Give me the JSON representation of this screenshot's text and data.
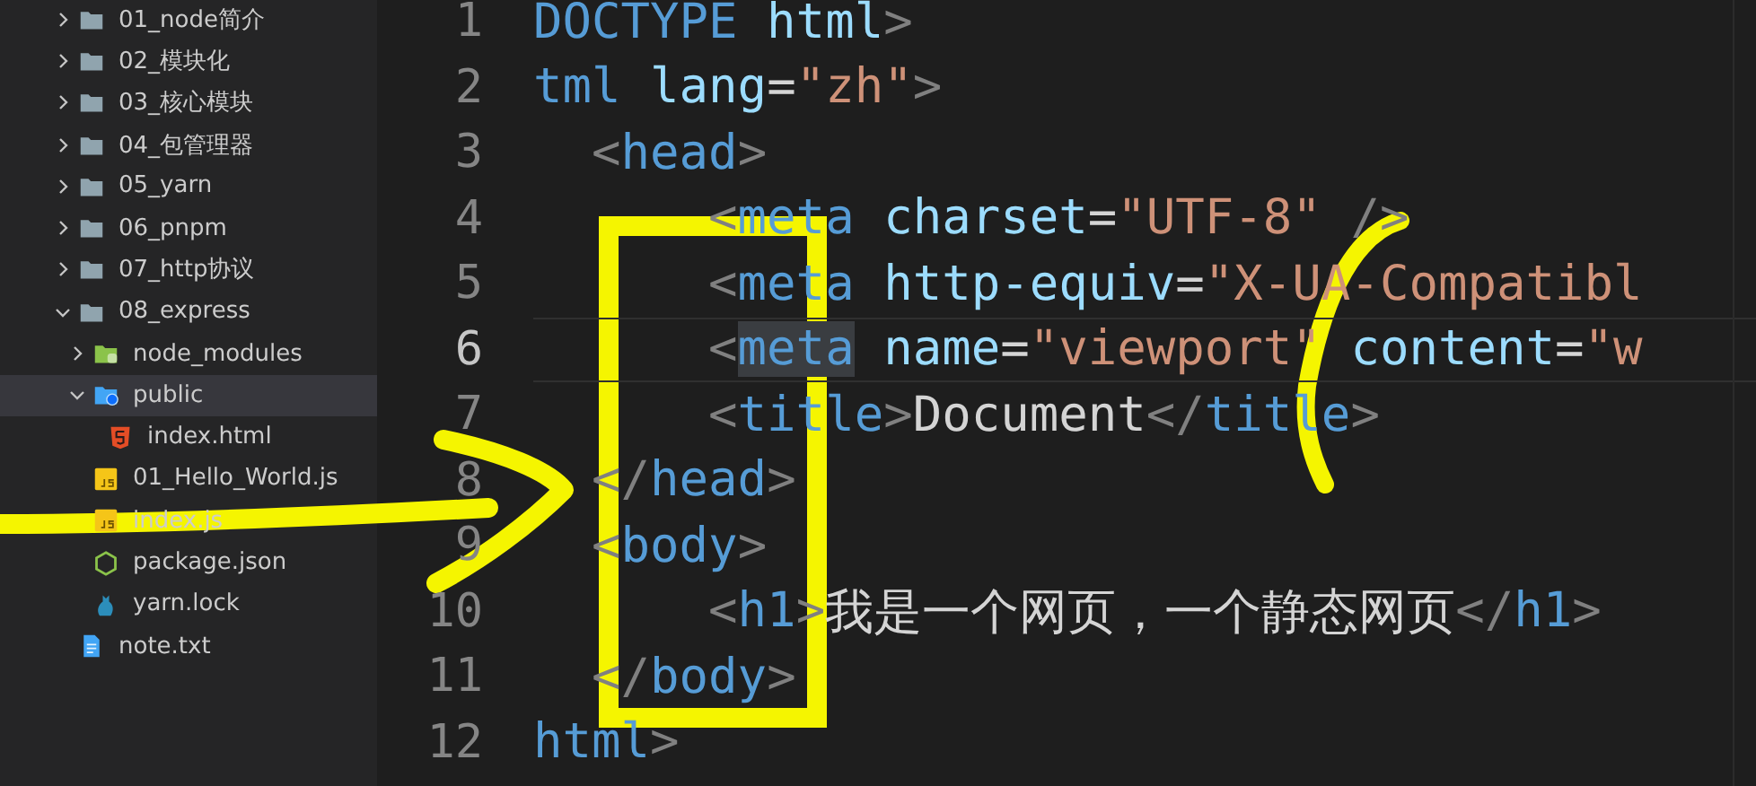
{
  "sidebar": {
    "items": [
      {
        "label": "01_node简介",
        "kind": "folder",
        "expanded": false,
        "selected": false
      },
      {
        "label": "02_模块化",
        "kind": "folder",
        "expanded": false,
        "selected": false
      },
      {
        "label": "03_核心模块",
        "kind": "folder",
        "expanded": false,
        "selected": false
      },
      {
        "label": "04_包管理器",
        "kind": "folder",
        "expanded": false,
        "selected": false
      },
      {
        "label": "05_yarn",
        "kind": "folder",
        "expanded": false,
        "selected": false
      },
      {
        "label": "06_pnpm",
        "kind": "folder",
        "expanded": false,
        "selected": false
      },
      {
        "label": "07_http协议",
        "kind": "folder",
        "expanded": false,
        "selected": false
      },
      {
        "label": "08_express",
        "kind": "folder",
        "expanded": true,
        "selected": false,
        "children": [
          {
            "label": "node_modules",
            "kind": "node-folder",
            "expanded": false,
            "selected": false
          },
          {
            "label": "public",
            "kind": "web-folder",
            "expanded": true,
            "selected": true,
            "children": [
              {
                "label": "index.html",
                "kind": "html",
                "selected": false
              }
            ]
          },
          {
            "label": "01_Hello_World.js",
            "kind": "js",
            "selected": false
          },
          {
            "label": "index.js",
            "kind": "js",
            "selected": false
          },
          {
            "label": "package.json",
            "kind": "npm",
            "selected": false
          },
          {
            "label": "yarn.lock",
            "kind": "yarn",
            "selected": false
          }
        ]
      },
      {
        "label": "note.txt",
        "kind": "txt",
        "selected": false
      }
    ]
  },
  "code": {
    "lines": [
      {
        "number": "1",
        "current": false,
        "tokens": [
          {
            "kind": "tag",
            "text": "DOCTYPE"
          },
          {
            "kind": "attr",
            "text": " html"
          },
          {
            "kind": "punct",
            "text": ">"
          }
        ]
      },
      {
        "number": "2",
        "current": false,
        "tokens": [
          {
            "kind": "tag",
            "text": "tml"
          },
          {
            "kind": "attr",
            "text": " lang"
          },
          {
            "kind": "text",
            "text": "="
          },
          {
            "kind": "str",
            "text": "\"zh\""
          },
          {
            "kind": "punct",
            "text": ">"
          }
        ]
      },
      {
        "number": "3",
        "current": false,
        "tokens": [
          {
            "kind": "punct",
            "text": "  <"
          },
          {
            "kind": "tag",
            "text": "head"
          },
          {
            "kind": "punct",
            "text": ">"
          }
        ]
      },
      {
        "number": "4",
        "current": false,
        "tokens": [
          {
            "kind": "punct",
            "text": "      <"
          },
          {
            "kind": "tag",
            "text": "meta"
          },
          {
            "kind": "attr",
            "text": " charset"
          },
          {
            "kind": "text",
            "text": "="
          },
          {
            "kind": "str",
            "text": "\"UTF-8\""
          },
          {
            "kind": "punct",
            "text": " />"
          }
        ]
      },
      {
        "number": "5",
        "current": false,
        "tokens": [
          {
            "kind": "punct",
            "text": "      <"
          },
          {
            "kind": "tag",
            "text": "meta"
          },
          {
            "kind": "attr",
            "text": " http-equiv"
          },
          {
            "kind": "text",
            "text": "="
          },
          {
            "kind": "str",
            "text": "\"X-UA-Compatibl"
          }
        ]
      },
      {
        "number": "6",
        "current": true,
        "tokens": [
          {
            "kind": "punct",
            "text": "      <"
          },
          {
            "kind": "tag-match",
            "text": "meta"
          },
          {
            "kind": "attr",
            "text": " name"
          },
          {
            "kind": "text",
            "text": "="
          },
          {
            "kind": "str",
            "text": "\"viewport\""
          },
          {
            "kind": "attr",
            "text": " content"
          },
          {
            "kind": "text",
            "text": "="
          },
          {
            "kind": "str",
            "text": "\"w"
          }
        ]
      },
      {
        "number": "7",
        "current": false,
        "tokens": [
          {
            "kind": "punct",
            "text": "      <"
          },
          {
            "kind": "tag",
            "text": "title"
          },
          {
            "kind": "punct",
            "text": ">"
          },
          {
            "kind": "text",
            "text": "Document"
          },
          {
            "kind": "punct",
            "text": "</"
          },
          {
            "kind": "tag",
            "text": "title"
          },
          {
            "kind": "punct",
            "text": ">"
          }
        ]
      },
      {
        "number": "8",
        "current": false,
        "tokens": [
          {
            "kind": "punct",
            "text": "  </"
          },
          {
            "kind": "tag",
            "text": "head"
          },
          {
            "kind": "punct",
            "text": ">"
          }
        ]
      },
      {
        "number": "9",
        "current": false,
        "tokens": [
          {
            "kind": "punct",
            "text": "  <"
          },
          {
            "kind": "tag",
            "text": "body"
          },
          {
            "kind": "punct",
            "text": ">"
          }
        ]
      },
      {
        "number": "10",
        "current": false,
        "tokens": [
          {
            "kind": "punct",
            "text": "      <"
          },
          {
            "kind": "tag",
            "text": "h1"
          },
          {
            "kind": "punct",
            "text": ">"
          },
          {
            "kind": "text",
            "text": "我是一个网页，一个静态网页"
          },
          {
            "kind": "punct",
            "text": "</"
          },
          {
            "kind": "tag",
            "text": "h1"
          },
          {
            "kind": "punct",
            "text": ">"
          }
        ]
      },
      {
        "number": "11",
        "current": false,
        "tokens": [
          {
            "kind": "punct",
            "text": "  </"
          },
          {
            "kind": "tag",
            "text": "body"
          },
          {
            "kind": "punct",
            "text": ">"
          }
        ]
      },
      {
        "number": "12",
        "current": false,
        "tokens": [
          {
            "kind": "tag",
            "text": "html"
          },
          {
            "kind": "punct",
            "text": ">"
          }
        ]
      }
    ]
  }
}
